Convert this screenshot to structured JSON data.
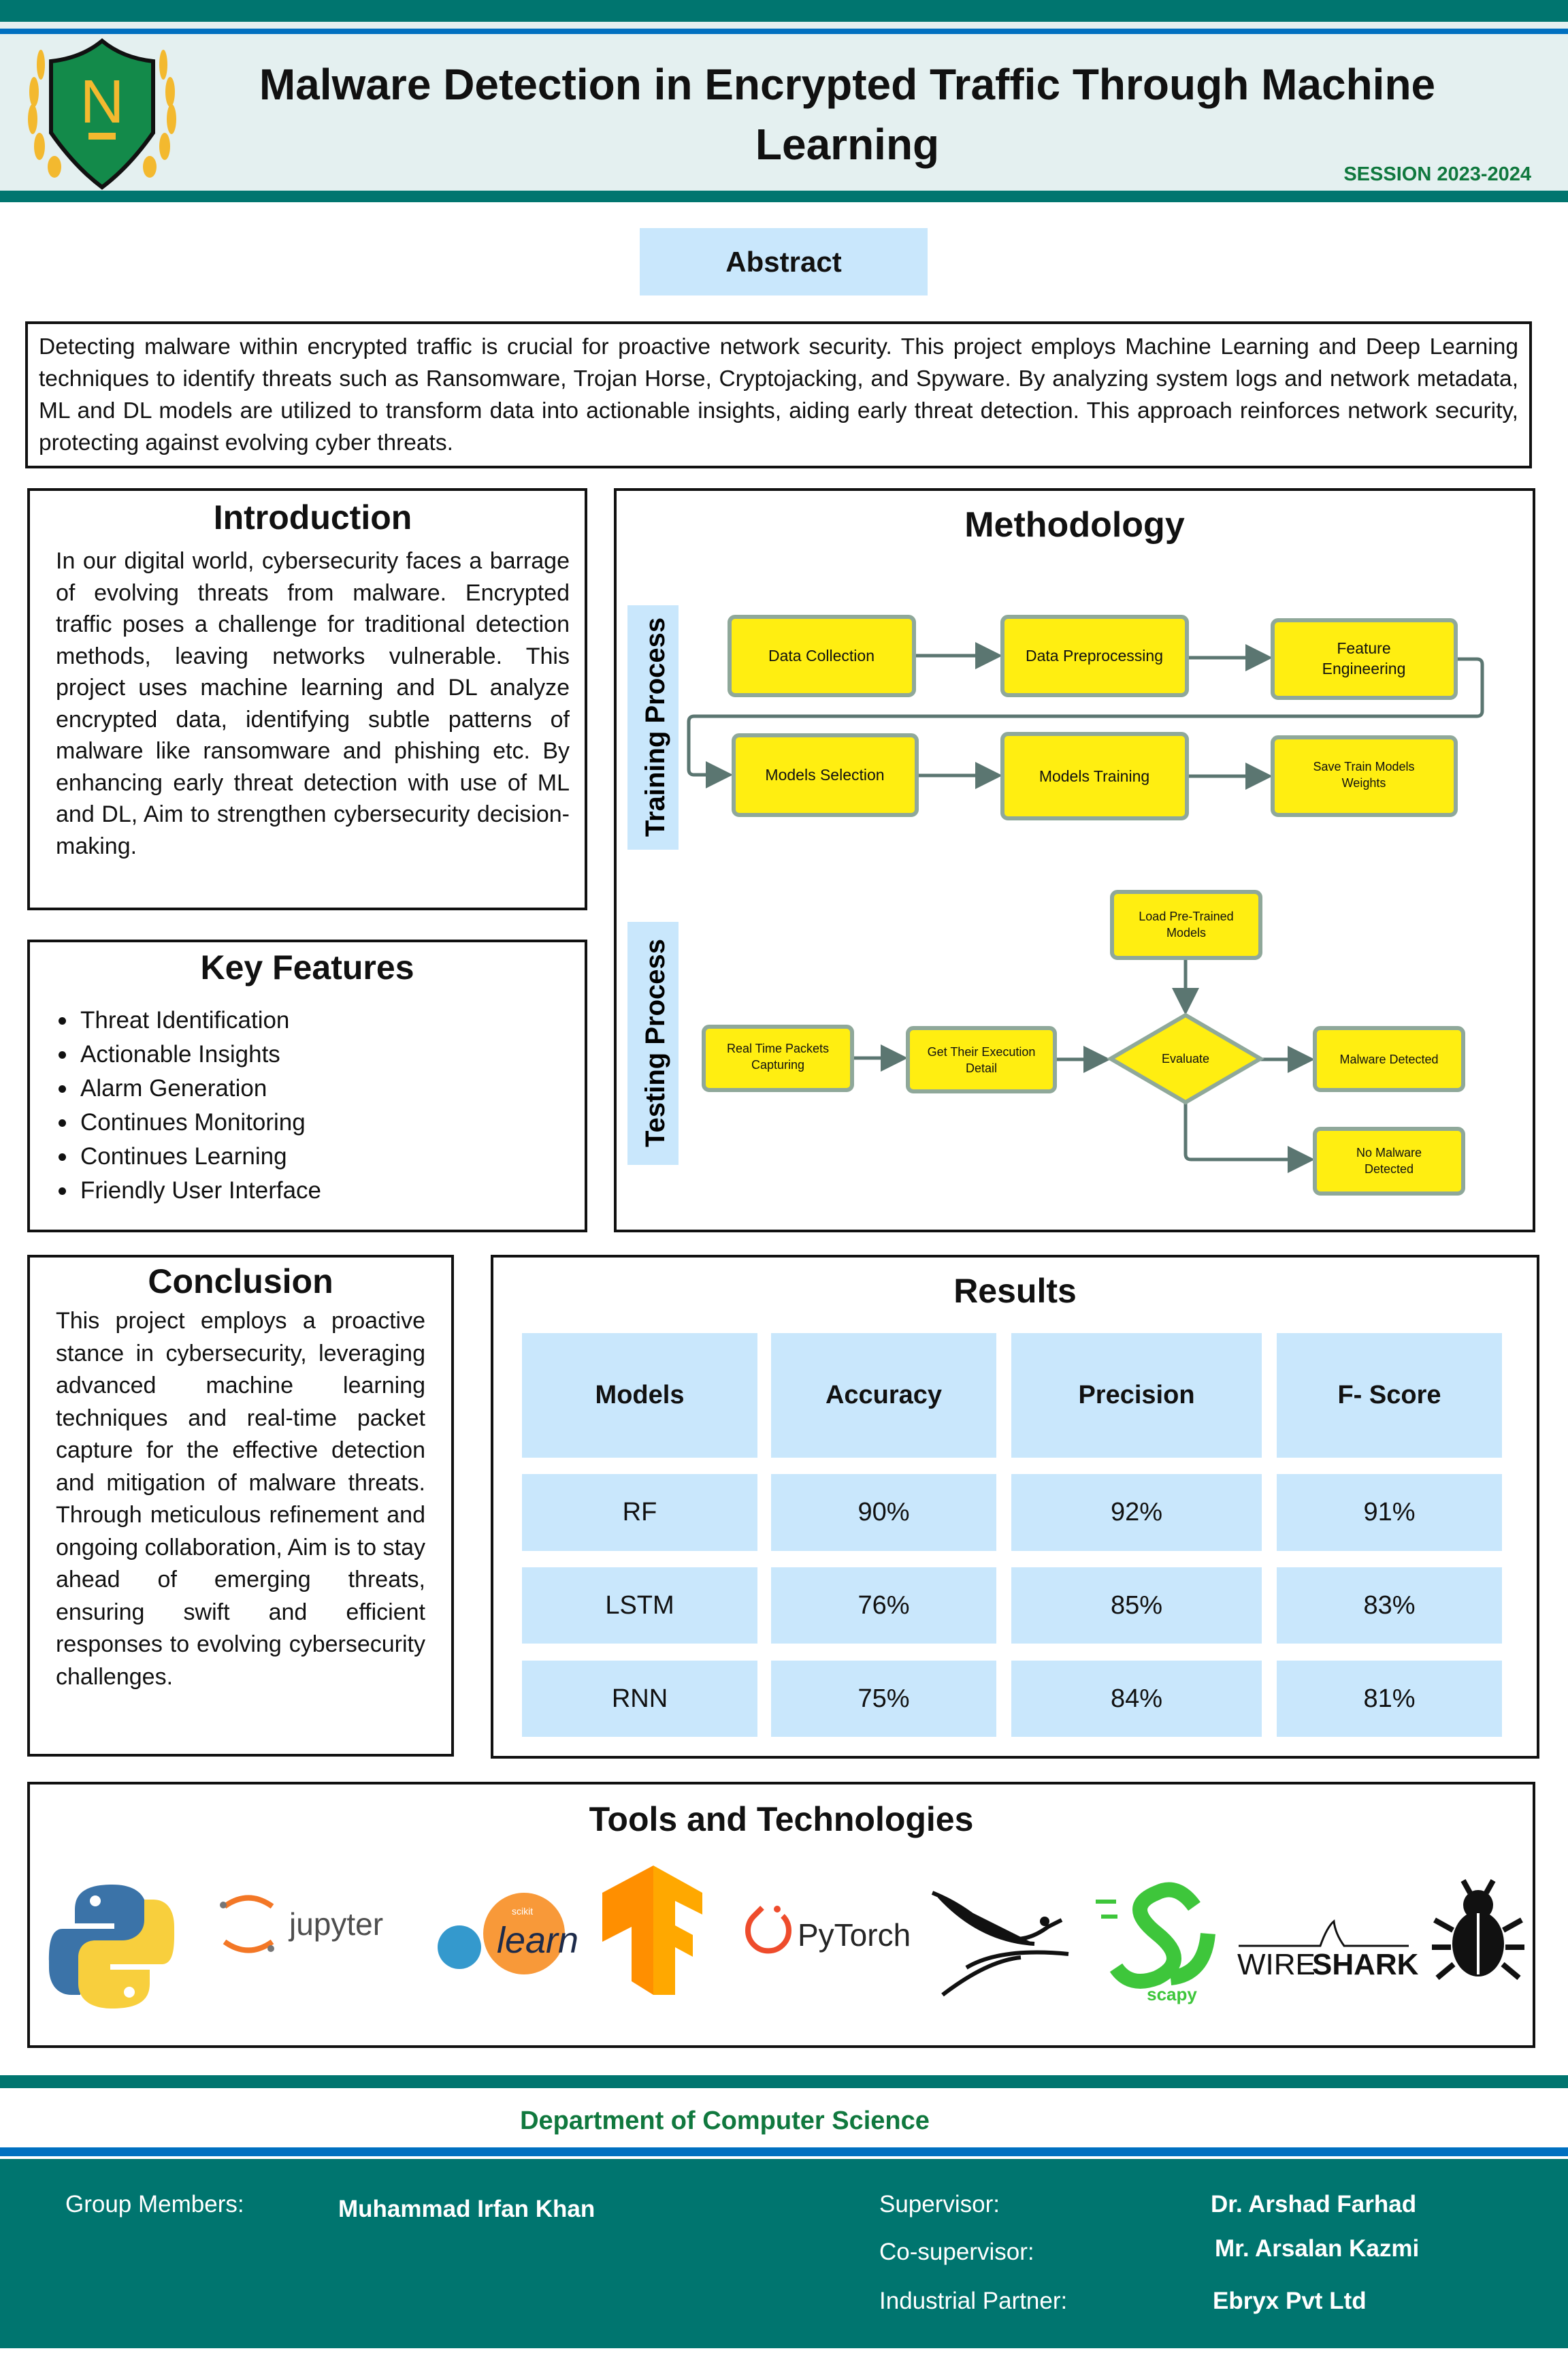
{
  "header": {
    "title_line1": "Malware Detection in Encrypted Traffic Through Machine",
    "title_line2": "Learning",
    "session": "SESSION 2023-2024",
    "logo_letter": "N"
  },
  "abstract": {
    "label": "Abstract",
    "text": "Detecting malware within encrypted traffic is crucial for proactive network security. This project employs Machine Learning and Deep Learning techniques to identify threats such as Ransomware, Trojan Horse, Cryptojacking, and Spyware. By analyzing system logs and network metadata, ML and DL models are utilized to transform data into actionable insights, aiding early threat detection. This approach reinforces network security, protecting against evolving cyber threats."
  },
  "introduction": {
    "title": "Introduction",
    "text": "In our digital world, cybersecurity faces a barrage of evolving threats from malware. Encrypted traffic poses a challenge for traditional detection methods, leaving networks vulnerable. This project uses machine learning and DL analyze encrypted data, identifying subtle patterns of malware like ransomware and phishing etc. By enhancing early threat detection with use of ML and DL, Aim to strengthen cybersecurity decision-making."
  },
  "key_features": {
    "title": "Key Features",
    "items": [
      "Threat Identification",
      "Actionable Insights",
      "Alarm Generation",
      "Continues Monitoring",
      "Continues Learning",
      "Friendly User Interface"
    ]
  },
  "methodology": {
    "title": "Methodology",
    "training_label": "Training Process",
    "testing_label": "Testing Process",
    "training_steps": [
      "Data Collection",
      "Data Preprocessing",
      "Feature",
      "Engineering",
      "Models Selection",
      "Models Training",
      "Save Train Models",
      "Weights"
    ],
    "testing_steps": {
      "load1": "Load Pre-Trained",
      "load2": "Models",
      "rt1": "Real Time Packets",
      "rt2": "Capturing",
      "ge1": "Get Their Execution",
      "ge2": "Detail",
      "evaluate": "Evaluate",
      "malware": "Malware Detected",
      "nm1": "No Malware",
      "nm2": "Detected"
    }
  },
  "conclusion": {
    "title": "Conclusion",
    "text": "This project employs a proactive stance in cybersecurity, leveraging advanced machine learning techniques and real-time packet capture for the effective detection and mitigation of malware threats. Through meticulous refinement and ongoing collaboration, Aim is to stay ahead of emerging threats, ensuring swift and efficient responses to evolving cybersecurity challenges."
  },
  "results": {
    "title": "Results",
    "headers": [
      "Models",
      "Accuracy",
      "Precision",
      "F- Score"
    ],
    "rows": [
      [
        "RF",
        "90%",
        "92%",
        "91%"
      ],
      [
        "LSTM",
        "76%",
        "85%",
        "83%"
      ],
      [
        "RNN",
        "75%",
        "84%",
        "81%"
      ]
    ]
  },
  "tools": {
    "title": "Tools and Technologies",
    "jupyter": "jupyter",
    "sklearn": "learn",
    "sklearn_small": "scikit",
    "pytorch": "PyTorch",
    "scapy": "scapy",
    "wireshark_a": "WIRE",
    "wireshark_b": "SHARK",
    "icons": [
      "python-logo",
      "jupyter-logo",
      "scikit-learn-logo",
      "tensorflow-logo",
      "pytorch-logo",
      "bird-logo",
      "scapy-logo",
      "wireshark-logo",
      "bug-icon"
    ]
  },
  "footer": {
    "department": "Department of Computer Science",
    "group_label": "Group Members:",
    "group_member": "Muhammad Irfan Khan",
    "supervisor_label": "Supervisor:",
    "supervisor": "Dr. Arshad Farhad",
    "cosupervisor_label": "Co-supervisor:",
    "cosupervisor": "Mr. Arsalan Kazmi",
    "partner_label": "Industrial Partner:",
    "partner": "Ebryx Pvt Ltd"
  },
  "colors": {
    "teal": "#00756f",
    "blue": "#0070c0",
    "light_blue": "#c9e7fc",
    "yellow": "#ffee11",
    "green": "#10783e"
  }
}
